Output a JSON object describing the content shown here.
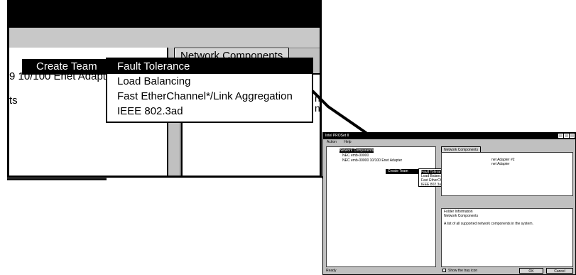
{
  "inset": {
    "tree_top_fragment": "ts",
    "context_item_label": "Create Team",
    "adapter_fragment": "9 10/100 Enet Adapt",
    "tab_label": "Network Components",
    "clipped_right_1": "ne",
    "clipped_right_2": "ne",
    "submenu": [
      {
        "label": "Fault Tolerance",
        "selected": true
      },
      {
        "label": "Load Balancing",
        "selected": false
      },
      {
        "label": "Fast EtherChannel*/Link Aggregation",
        "selected": false
      },
      {
        "label": "IEEE 802.3ad",
        "selected": false
      }
    ]
  },
  "window": {
    "title": "Intel PROSet II",
    "menu": [
      "Action",
      "Help"
    ],
    "tree_root": "Network Components",
    "tree_items": [
      "NEC emb-00000",
      "NEC emb-00000 10/100 Enet Adapter"
    ],
    "context_item": "Create Team",
    "submenu": [
      "Fault Tolerance",
      "Load Balancing",
      "Fast EtherChannel*/Link Aggregation",
      "IEEE 802.3ad"
    ],
    "tab_label": "Network Components",
    "right_items": [
      "net Adapter #2",
      "net Adapter"
    ],
    "folder_info_title": "Folder Information",
    "folder_info_name": "Network Components",
    "folder_info_desc": "A list of all supported network components in the system.",
    "status": "Ready",
    "tray_checkbox_label": "Show the tray icon",
    "ok_label": "OK",
    "cancel_label": "Cancel"
  }
}
